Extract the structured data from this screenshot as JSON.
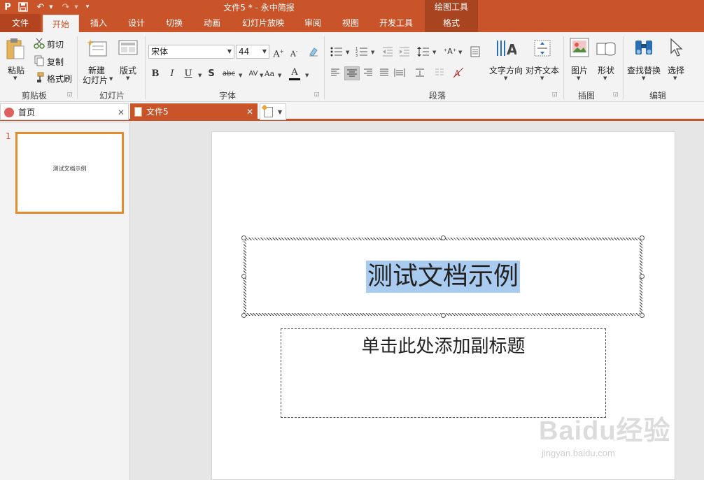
{
  "app": {
    "window_title": "文件5 * - 永中简报",
    "contextual_tab_header": "绘图工具"
  },
  "quick_access": {
    "logo_letter": "P"
  },
  "tabs": [
    {
      "label": "文件"
    },
    {
      "label": "开始"
    },
    {
      "label": "插入"
    },
    {
      "label": "设计"
    },
    {
      "label": "切换"
    },
    {
      "label": "动画"
    },
    {
      "label": "幻灯片放映"
    },
    {
      "label": "审阅"
    },
    {
      "label": "视图"
    },
    {
      "label": "开发工具"
    },
    {
      "label": "格式"
    }
  ],
  "ribbon": {
    "clipboard": {
      "paste": "粘贴",
      "cut": "剪切",
      "copy": "复制",
      "format_painter": "格式刷",
      "group": "剪贴板"
    },
    "slides": {
      "new_slide_line1": "新建",
      "new_slide_line2": "幻灯片",
      "layout": "版式",
      "group": "幻灯片"
    },
    "font": {
      "font_name": "宋体",
      "font_size": "44",
      "group": "字体"
    },
    "paragraph": {
      "group": "段落"
    },
    "text_tools": {
      "text_direction": "文字方向",
      "align_text": "对齐文本"
    },
    "insert": {
      "picture": "图片",
      "shape": "形状",
      "group": "插图"
    },
    "editing": {
      "find_replace": "查找替换",
      "select": "选择",
      "group": "编辑"
    }
  },
  "doc_tabs": [
    {
      "label": "首页"
    },
    {
      "label": "文件5"
    }
  ],
  "slide_panel": {
    "slide_number": "1",
    "thumb_title": "测试文档示例"
  },
  "slide": {
    "title": "测试文档示例",
    "subtitle_placeholder": "单击此处添加副标题"
  },
  "watermark": {
    "brand": "Baidu经验",
    "url": "jingyan.baidu.com"
  },
  "colors": {
    "accent": "#c9542a",
    "thumb_border": "#e68a2e",
    "selection": "#a8cbef"
  }
}
